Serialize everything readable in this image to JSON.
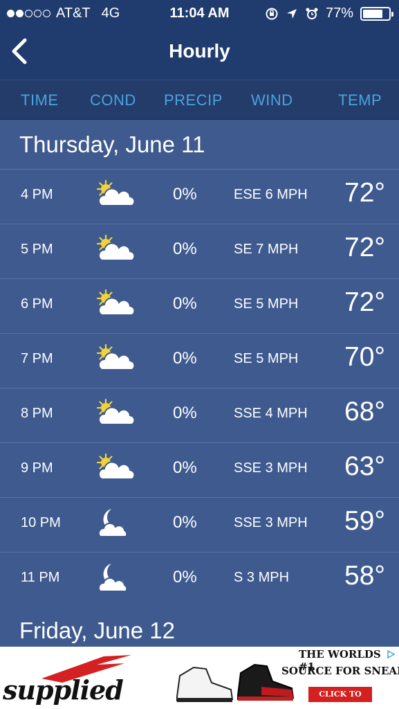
{
  "status_bar": {
    "carrier": "AT&T",
    "network": "4G",
    "time": "11:04 AM",
    "battery": "77%",
    "battery_level": 0.77,
    "signal_bars_filled": 2,
    "signal_bars_total": 5
  },
  "nav": {
    "title": "Hourly",
    "back_icon": "chevron-left-icon"
  },
  "columns": {
    "time": "TIME",
    "cond": "COND",
    "precip": "PRECIP",
    "wind": "WIND",
    "temp": "TEMP"
  },
  "days": [
    {
      "label": "Thursday, June 11",
      "hours": [
        {
          "time": "4 PM",
          "icon": "partly-cloudy-day-icon",
          "precip": "0%",
          "wind": "ESE 6 MPH",
          "temp": "72°"
        },
        {
          "time": "5 PM",
          "icon": "partly-cloudy-day-icon",
          "precip": "0%",
          "wind": "SE 7 MPH",
          "temp": "72°"
        },
        {
          "time": "6 PM",
          "icon": "partly-cloudy-day-icon",
          "precip": "0%",
          "wind": "SE 5 MPH",
          "temp": "72°"
        },
        {
          "time": "7 PM",
          "icon": "partly-cloudy-day-icon",
          "precip": "0%",
          "wind": "SE 5 MPH",
          "temp": "70°"
        },
        {
          "time": "8 PM",
          "icon": "partly-cloudy-day-icon",
          "precip": "0%",
          "wind": "SSE 4 MPH",
          "temp": "68°"
        },
        {
          "time": "9 PM",
          "icon": "partly-cloudy-day-icon",
          "precip": "0%",
          "wind": "SSE 3 MPH",
          "temp": "63°"
        },
        {
          "time": "10 PM",
          "icon": "mostly-clear-night-icon",
          "precip": "0%",
          "wind": "SSE 3 MPH",
          "temp": "59°"
        },
        {
          "time": "11 PM",
          "icon": "mostly-clear-night-icon",
          "precip": "0%",
          "wind": "S 3 MPH",
          "temp": "58°"
        }
      ]
    },
    {
      "label": "Friday, June 12",
      "hours": []
    }
  ],
  "ad": {
    "brand": "supplied",
    "tagline_1": "THE WORLDS #1",
    "tagline_2": "SOURCE FOR SNEAKERS",
    "cta": "CLICK TO SHOP"
  },
  "colors": {
    "accent": "#4aa3df",
    "header_bg": "#203b6e",
    "content_bg": "#3e5a8f",
    "sun": "#f2d23a"
  }
}
